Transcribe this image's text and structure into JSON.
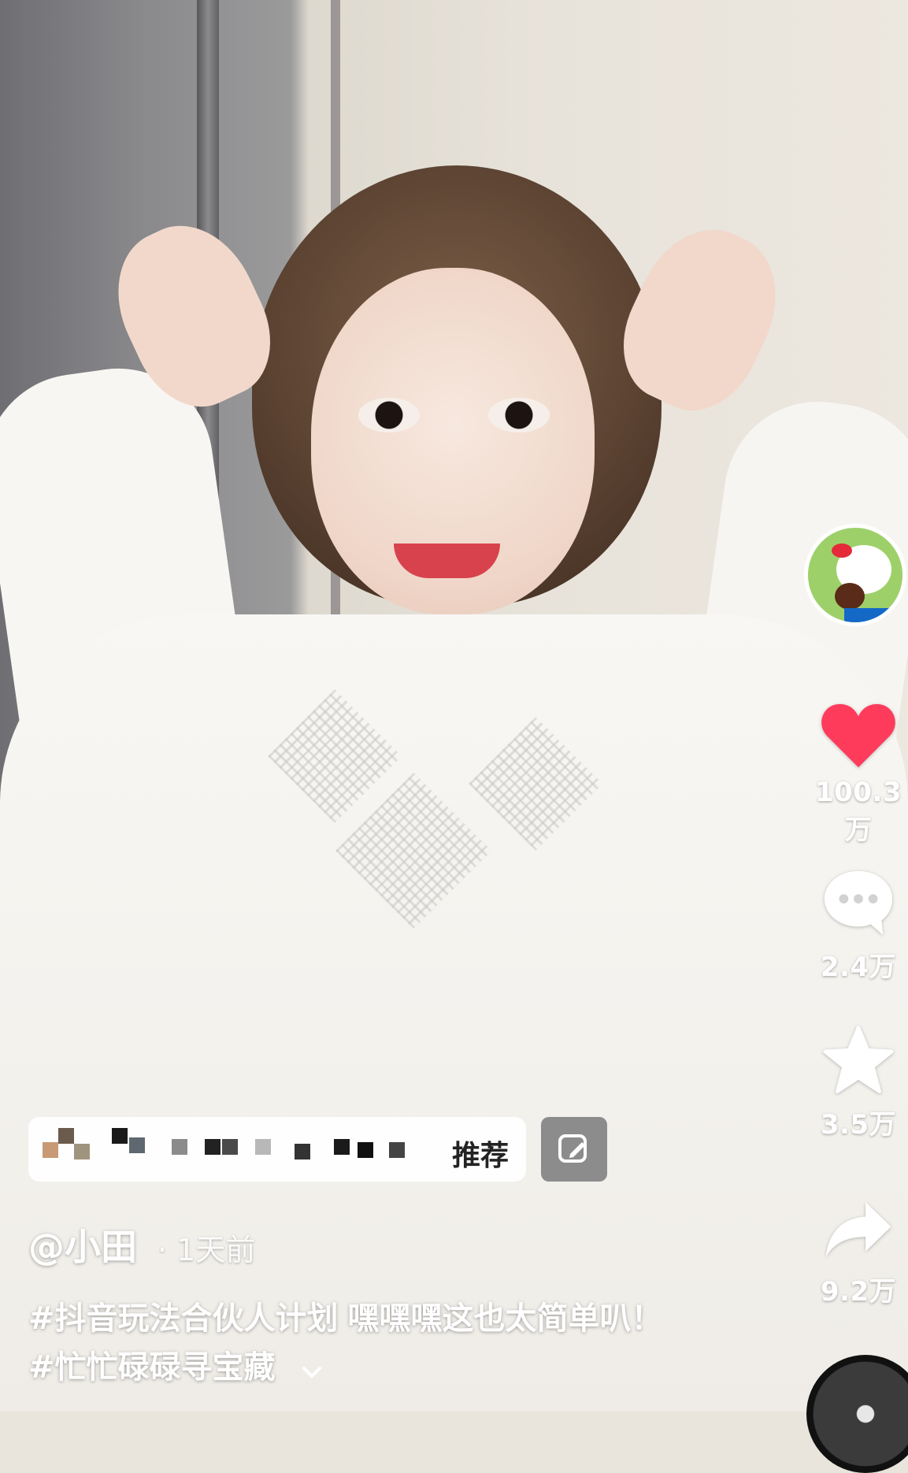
{
  "creator": {
    "username": "@小田",
    "time_ago": "1天前"
  },
  "caption": {
    "hashtag_1": "#抖音玩法合伙人计划",
    "text": "嘿嘿嘿这也太简单叭！",
    "hashtag_2": "#忙忙碌碌寻宝藏"
  },
  "recommendation_bar": {
    "label": "推荐"
  },
  "actions": {
    "likes": "100.3万",
    "comments": "2.4万",
    "favorites": "3.5万",
    "shares": "9.2万"
  },
  "colors": {
    "like_red": "#ff3b5c",
    "overlay_white": "#ffffff",
    "edit_button_bg": "#7d7d80"
  },
  "icons": {
    "avatar": "hello-kitty-avatar",
    "like": "heart-icon",
    "comment": "comment-bubble-icon",
    "favorite": "star-icon",
    "share": "share-arrow-icon",
    "edit": "edit-icon",
    "expand": "chevron-down-icon",
    "music": "music-disc-icon"
  }
}
